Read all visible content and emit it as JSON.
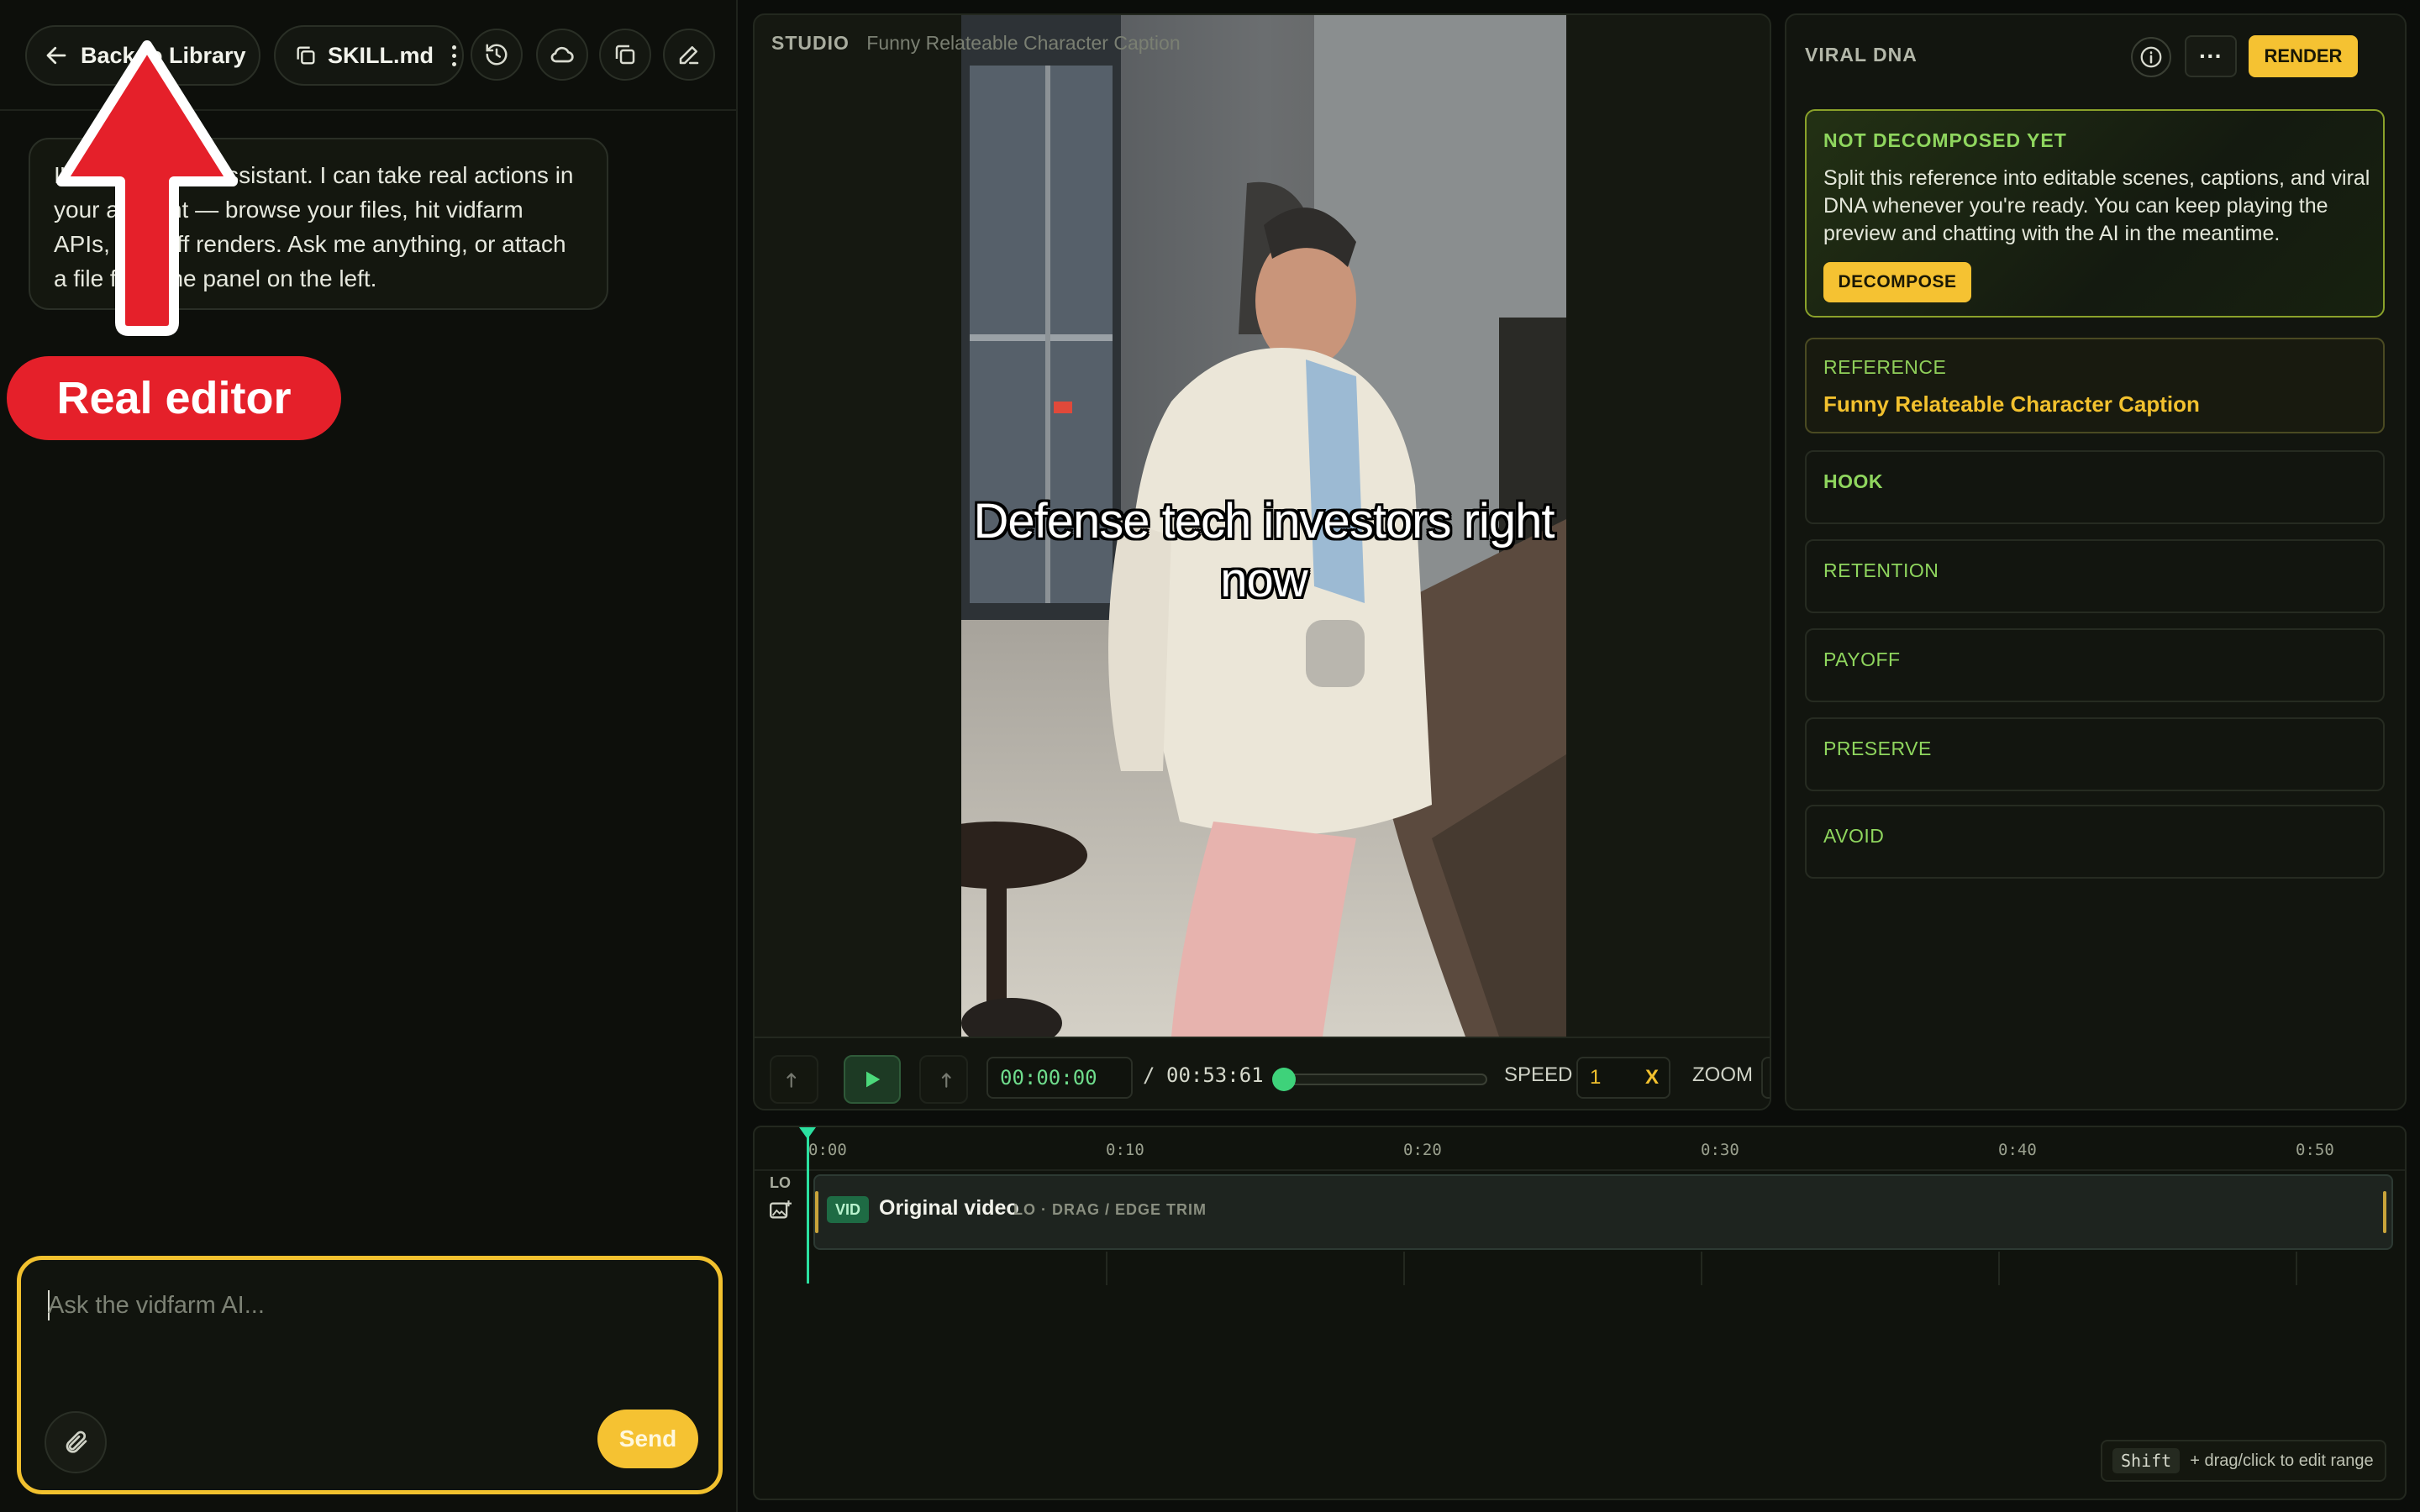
{
  "header": {
    "back_label": "Back to Library",
    "skill_label": "SKILL.md"
  },
  "chat": {
    "bubble_text": "I'm the vidfarm assistant. I can take real actions in your account — browse your files, hit vidfarm APIs, kick off renders. Ask me anything, or attach a file from the panel on the left.",
    "input_placeholder": "Ask the vidfarm AI...",
    "send_label": "Send"
  },
  "annotation": {
    "badge_label": "Real editor"
  },
  "studio": {
    "breadcrumb_section": "STUDIO",
    "breadcrumb_title": "Funny Relateable Character Caption",
    "video_caption": "Defense tech investors right now",
    "current_time": "00:00:00",
    "separator": "/",
    "duration": "00:53:61",
    "speed_label": "SPEED",
    "speed_value": "1",
    "speed_reset": "X",
    "zoom_label": "ZOOM",
    "progress": 0
  },
  "dna": {
    "title": "VIRAL DNA",
    "more_label": "···",
    "render_label": "RENDER",
    "not_decomposed_heading": "NOT DECOMPOSED YET",
    "not_decomposed_body": "Split this reference into editable scenes, captions, and viral DNA whenever you're ready. You can keep playing the preview and chatting with the AI in the meantime.",
    "decompose_label": "DECOMPOSE",
    "reference_label": "REFERENCE",
    "reference_value": "Funny Relateable Character Caption",
    "sections": [
      "HOOK",
      "RETENTION",
      "PAYOFF",
      "PRESERVE",
      "AVOID"
    ]
  },
  "timeline": {
    "ticks": [
      "0:00",
      "0:10",
      "0:20",
      "0:30",
      "0:40",
      "0:50"
    ],
    "lane_label": "LO",
    "clip_badge": "VID",
    "clip_name": "Original video",
    "clip_hint": "LO · DRAG / EDGE TRIM",
    "tip_key": "Shift",
    "tip_text": "+ drag/click to edit range"
  },
  "colors": {
    "accent_yellow": "#f5c232",
    "accent_green": "#8fd65e",
    "annotation_red": "#e5202a",
    "playhead": "#2be0a0"
  }
}
